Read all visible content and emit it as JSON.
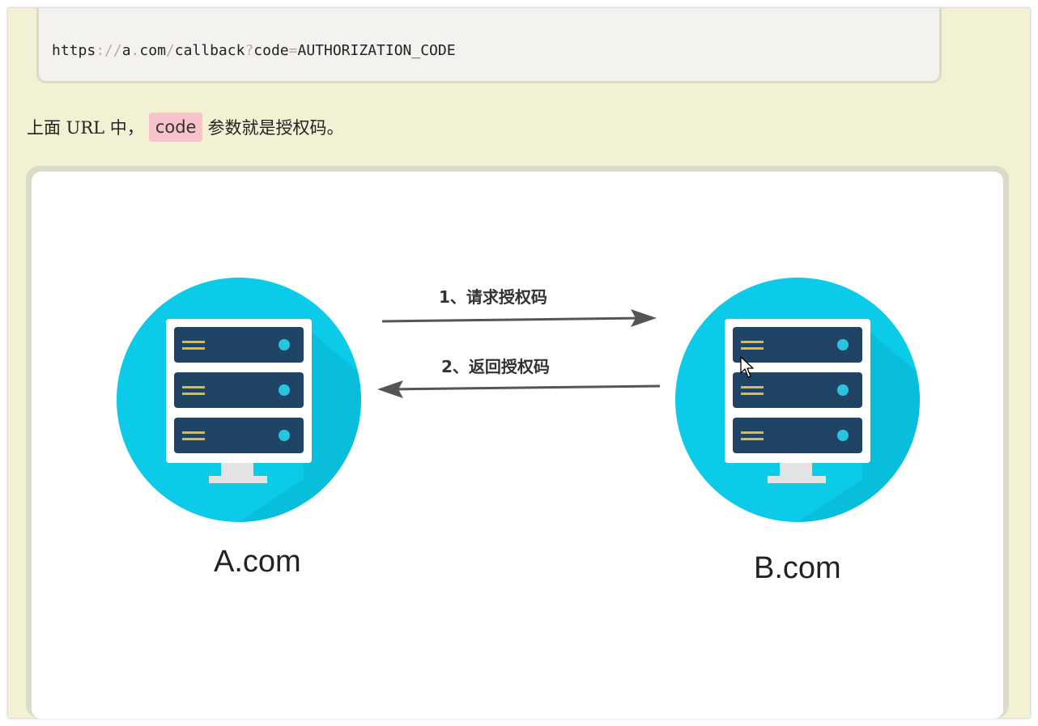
{
  "code_block": {
    "scheme": "https",
    "sep1": "://",
    "host": "a",
    "dot": ".",
    "domain": "com",
    "slash": "/",
    "path": "callback",
    "q": "?",
    "param_name": "code",
    "eq": "=",
    "param_value": "AUTHORIZATION_CODE"
  },
  "paragraph": {
    "before": "上面 URL 中，",
    "code": "code",
    "after": "参数就是授权码。"
  },
  "diagram": {
    "arrow1_label": "1、请求授权码",
    "arrow2_label": "2、返回授权码",
    "host_a": "A.com",
    "host_b": "B.com"
  },
  "colors": {
    "page_bg": "#f3f1d3",
    "code_bg": "#f4f2ef",
    "inline_code_bg": "#f7c2c9",
    "server_circle": "#0ccbe8",
    "server_dark": "#1f4466",
    "server_light": "#29c4df",
    "server_stripe": "#e8b73d",
    "arrow": "#555555"
  }
}
